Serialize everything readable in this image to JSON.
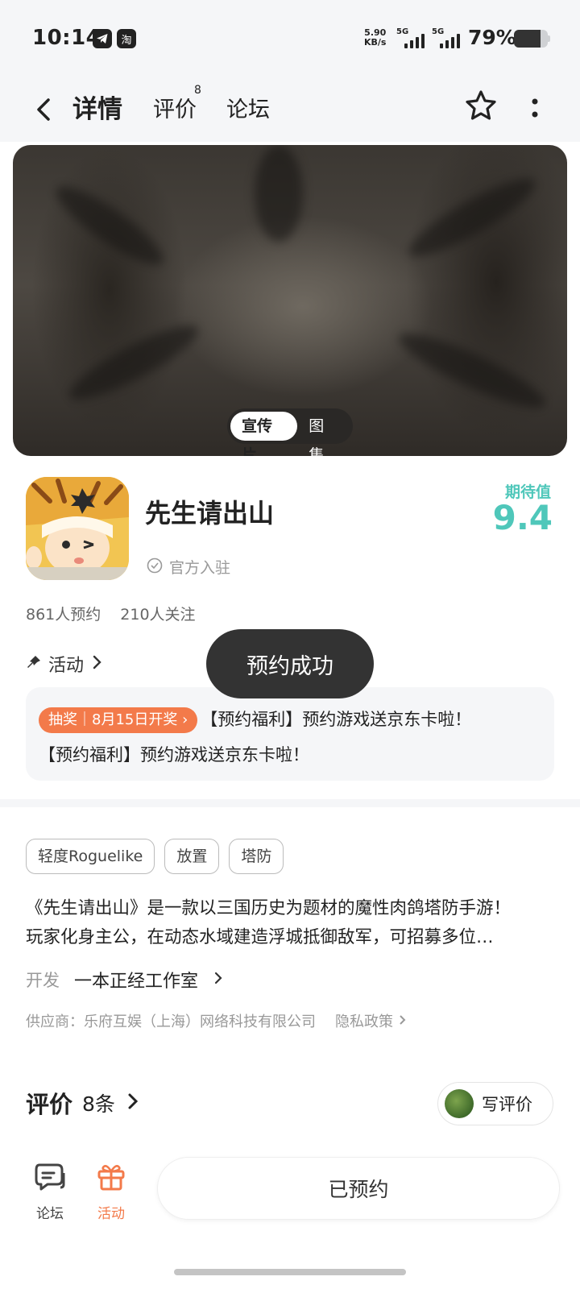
{
  "status_bar": {
    "time": "10:14",
    "app_icons": [
      "telegram-icon",
      "taobao-icon"
    ],
    "taobao_glyph": "淘",
    "net_speed_value": "5.90",
    "net_speed_unit": "KB/s",
    "network_1": "5G",
    "network_2": "5G",
    "battery_percent": "79%",
    "battery_level": 0.79
  },
  "nav": {
    "tabs": [
      {
        "label": "详情",
        "active": true
      },
      {
        "label": "评价",
        "badge": "8"
      },
      {
        "label": "论坛"
      }
    ],
    "accent_color": "#5ed3c7"
  },
  "hero": {
    "switch": [
      {
        "label": "宣传片",
        "active": true
      },
      {
        "label": "图集"
      }
    ]
  },
  "game": {
    "title": "先生请出山",
    "official_label": "官方入驻",
    "expect_label": "期待值",
    "expect_score": "9.4",
    "reservations": "861人预约",
    "followers": "210人关注"
  },
  "activity": {
    "label": "活动",
    "tag": "抽奖｜8月15日开奖",
    "line1": "【预约福利】预约游戏送京东卡啦！",
    "line2": "【预约福利】预约游戏送京东卡啦！",
    "tag_color": "#f37a4a"
  },
  "toast": "预约成功",
  "tags": [
    "轻度Roguelike",
    "放置",
    "塔防"
  ],
  "description": {
    "line1": "《先生请出山》是一款以三国历史为题材的魔性肉鸽塔防手游！",
    "line2": "玩家化身主公，在动态水域建造浮城抵御敌军，可招募多位…"
  },
  "developer": {
    "key": "开发",
    "value": "一本正经工作室"
  },
  "supplier": {
    "text": "供应商：乐府互娱（上海）网络科技有限公司",
    "privacy": "隐私政策"
  },
  "reviews": {
    "title": "评价",
    "count": "8条",
    "write_label": "写评价"
  },
  "bottom_bar": {
    "forum_label": "论坛",
    "activity_label": "活动",
    "reserved_label": "已预约"
  }
}
